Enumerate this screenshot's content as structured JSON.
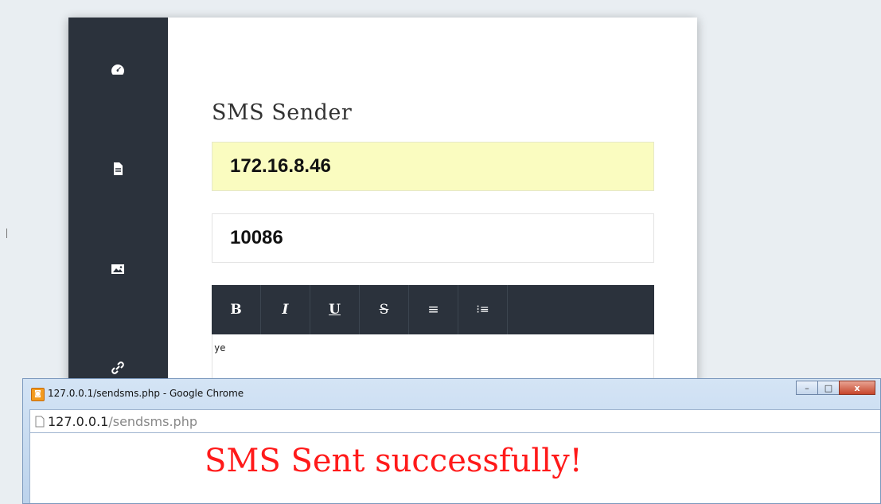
{
  "app": {
    "title": "SMS Sender",
    "ip_value": "172.16.8.46",
    "number_value": "10086",
    "message_text": "ye",
    "toolbar": [
      {
        "label": "B",
        "name": "bold"
      },
      {
        "label": "I",
        "name": "italic"
      },
      {
        "label": "U",
        "name": "underline"
      },
      {
        "label": "S",
        "name": "strikethrough"
      },
      {
        "label": "≡",
        "name": "bullet-list"
      },
      {
        "label": "⁝≡",
        "name": "numbered-list"
      }
    ],
    "sidebar_icons": [
      "dashboard-icon",
      "document-icon",
      "image-icon",
      "link-icon"
    ]
  },
  "popup": {
    "window_title": "127.0.0.1/sendsms.php - Google Chrome",
    "url_host": "127.0.0.1",
    "url_path": "/sendsms.php",
    "message": "SMS Sent successfully!",
    "controls": {
      "minimize": "–",
      "maximize": "□",
      "close": "x"
    }
  }
}
